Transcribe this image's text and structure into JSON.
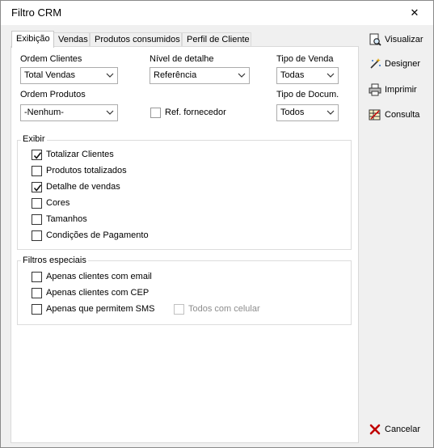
{
  "window": {
    "title": "Filtro CRM",
    "close_glyph": "✕"
  },
  "tabs": [
    {
      "label": "Exibição",
      "active": true
    },
    {
      "label": "Vendas"
    },
    {
      "label": "Produtos consumidos"
    },
    {
      "label": "Perfil de Cliente"
    }
  ],
  "fields": {
    "ordem_clientes": {
      "label": "Ordem Clientes",
      "value": "Total Vendas"
    },
    "nivel_detalhe": {
      "label": "Nível de detalhe",
      "value": "Referência"
    },
    "tipo_venda": {
      "label": "Tipo de Venda",
      "value": "Todas"
    },
    "ordem_produtos": {
      "label": "Ordem Produtos",
      "value": "-Nenhum-"
    },
    "ref_fornecedor": {
      "label": "Ref. fornecedor",
      "checked": false
    },
    "tipo_docum": {
      "label": "Tipo de Docum.",
      "value": "Todos"
    }
  },
  "exibir": {
    "title": "Exibir",
    "items": [
      {
        "label": "Totalizar Clientes",
        "checked": true
      },
      {
        "label": "Produtos totalizados",
        "checked": false
      },
      {
        "label": "Detalhe de vendas",
        "checked": true
      },
      {
        "label": "Cores",
        "checked": false
      },
      {
        "label": "Tamanhos",
        "checked": false
      },
      {
        "label": "Condições de Pagamento",
        "checked": false
      }
    ]
  },
  "filtros": {
    "title": "Filtros especiais",
    "items": [
      {
        "label": "Apenas clientes com email",
        "checked": false
      },
      {
        "label": "Apenas clientes com CEP",
        "checked": false
      },
      {
        "label": "Apenas que permitem SMS",
        "checked": false
      }
    ],
    "todos_celular": {
      "label": "Todos com celular",
      "checked": false,
      "disabled": true
    }
  },
  "actions": {
    "visualizar": {
      "label": "Visualizar",
      "icon": "magnifier-page-icon"
    },
    "designer": {
      "label": "Designer",
      "icon": "magic-wand-icon"
    },
    "imprimir": {
      "label": "Imprimir",
      "icon": "printer-icon"
    },
    "consulta": {
      "label": "Consulta",
      "icon": "query-grid-icon"
    },
    "cancelar": {
      "label": "Cancelar",
      "icon": "red-x-icon",
      "color": "#c00000"
    }
  }
}
